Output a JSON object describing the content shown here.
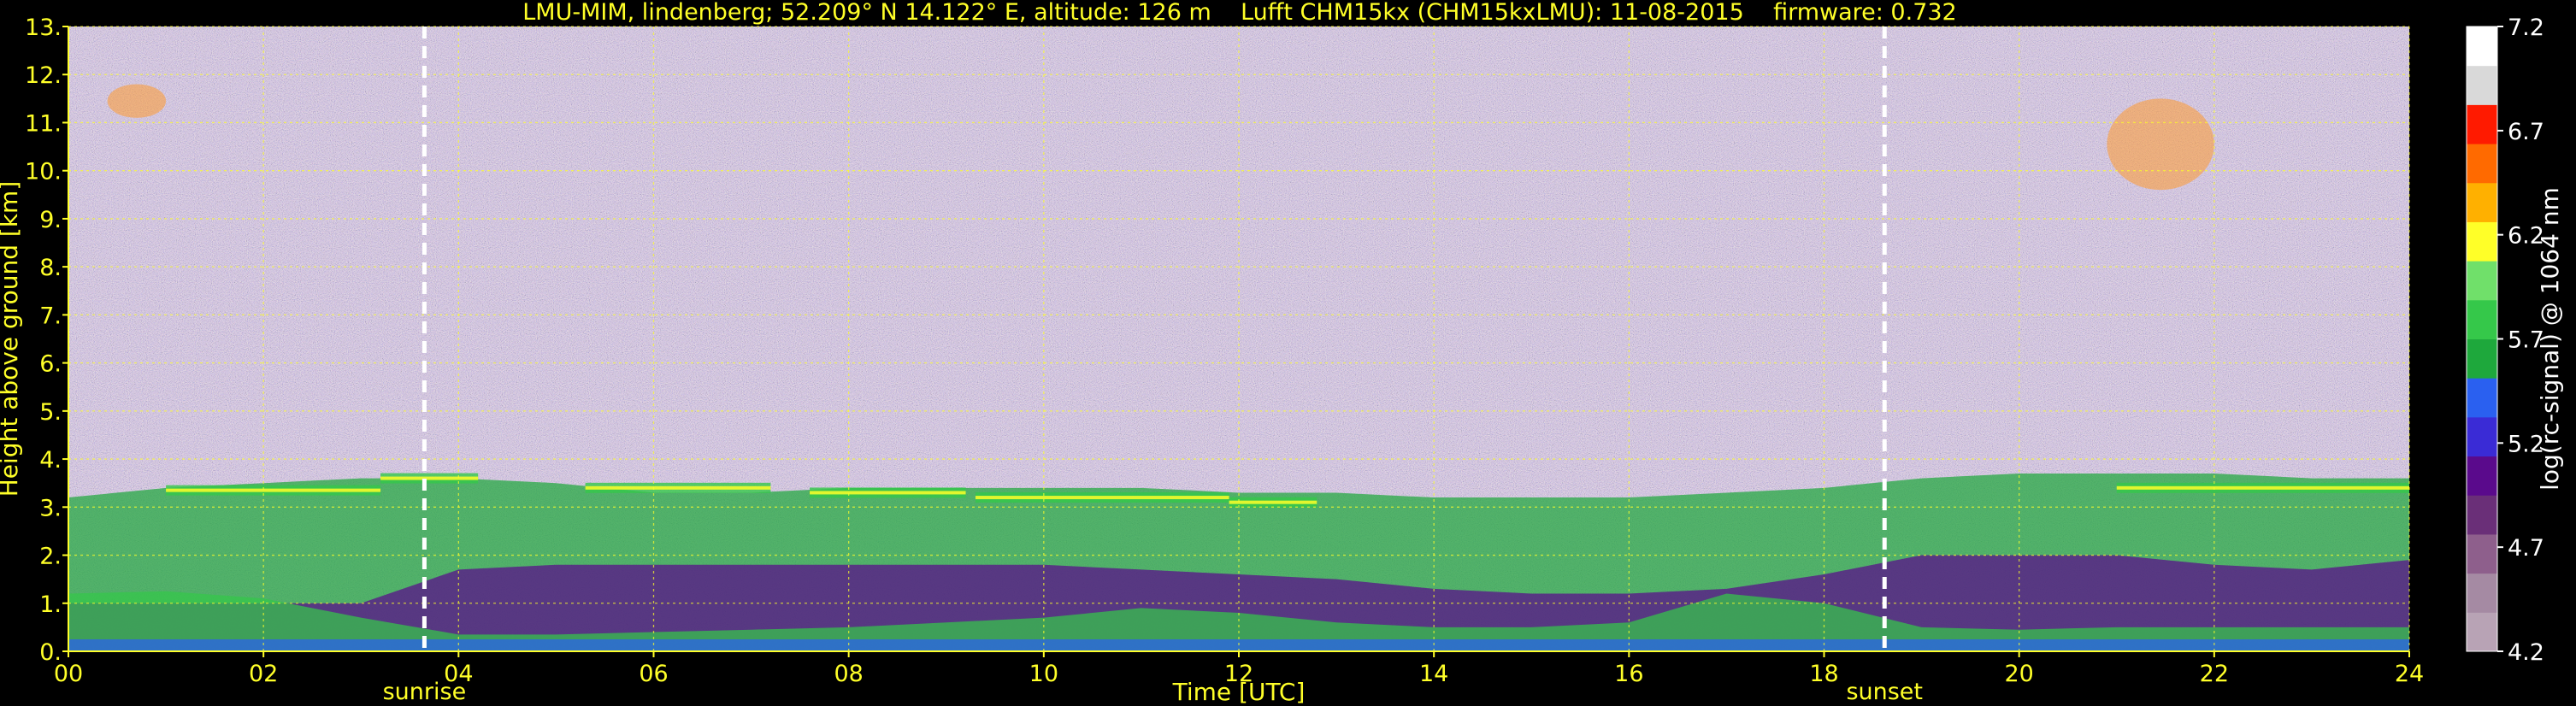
{
  "chart_data": {
    "type": "heatmap",
    "title": "LMU-MIM, lindenberg; 52.209° N 14.122° E, altitude: 126 m    Lufft CHM15kx (CHM15kxLMU): 11-08-2015    firmware: 0.732",
    "xlabel": "Time [UTC]",
    "ylabel": "Height above ground [km]",
    "xlim": [
      0,
      24
    ],
    "ylim": [
      0,
      13
    ],
    "x_ticks": [
      0,
      2,
      4,
      6,
      8,
      10,
      12,
      14,
      16,
      18,
      20,
      22,
      24
    ],
    "x_tick_labels": [
      "00",
      "02",
      "04",
      "06",
      "08",
      "10",
      "12",
      "14",
      "16",
      "18",
      "20",
      "22",
      "24"
    ],
    "y_ticks": [
      0,
      1,
      2,
      3,
      4,
      5,
      6,
      7,
      8,
      9,
      10,
      11,
      12,
      13
    ],
    "y_tick_labels": [
      "0.",
      "1.",
      "2.",
      "3.",
      "4.",
      "5.",
      "6.",
      "7.",
      "8.",
      "9.",
      "10.",
      "11.",
      "12.",
      "13."
    ],
    "grid": true,
    "events": [
      {
        "label": "sunrise",
        "x": 3.65
      },
      {
        "label": "sunset",
        "x": 18.62
      }
    ],
    "colorbar": {
      "label": "log(rc-signal) @ 1064 nm",
      "range": [
        4.2,
        7.2
      ],
      "tick_values": [
        4.2,
        4.7,
        5.2,
        5.7,
        6.2,
        6.7,
        7.2
      ],
      "tick_labels": [
        "4.2",
        "4.7",
        "5.2",
        "5.7",
        "6.2",
        "6.7",
        "7.2"
      ],
      "colors": [
        "#b8a3b5",
        "#a58aa3",
        "#8e5f8c",
        "#6a2f78",
        "#5a0a8c",
        "#3a2bd6",
        "#2a60f0",
        "#1ea83c",
        "#35c84a",
        "#70e06a",
        "#ffff28",
        "#ffb000",
        "#ff6a00",
        "#ff1a00",
        "#d9d9d9",
        "#ffffff"
      ]
    },
    "layers": [
      {
        "x": [
          0,
          1,
          2,
          3,
          4,
          5,
          6,
          7,
          8,
          9,
          10,
          11,
          12,
          13,
          14,
          15,
          16,
          17,
          18,
          19,
          20,
          21,
          22,
          23,
          24
        ],
        "y": [
          0.25,
          0.25,
          0.25,
          0.25,
          0.25,
          0.25,
          0.25,
          0.25,
          0.25,
          0.25,
          0.25,
          0.25,
          0.25,
          0.25,
          0.25,
          0.25,
          0.25,
          0.25,
          0.25,
          0.25,
          0.25,
          0.25,
          0.25,
          0.25,
          0.25
        ],
        "value": 5.45
      },
      {
        "x": [
          0,
          1,
          2,
          3,
          4,
          5,
          6,
          7,
          8,
          9,
          10,
          11,
          12,
          13,
          14,
          15,
          16,
          17,
          18,
          19,
          20,
          21,
          22,
          23,
          24
        ],
        "y": [
          1.2,
          1.25,
          1.1,
          0.7,
          0.35,
          0.35,
          0.4,
          0.45,
          0.5,
          0.6,
          0.7,
          0.9,
          0.8,
          0.6,
          0.5,
          0.5,
          0.6,
          1.2,
          1.0,
          0.5,
          0.45,
          0.5,
          0.5,
          0.5,
          0.5
        ],
        "value": 5.8
      },
      {
        "x": [
          0,
          1,
          2,
          3,
          4,
          5,
          6,
          7,
          8,
          9,
          10,
          11,
          12,
          13,
          14,
          15,
          16,
          17,
          18,
          19,
          20,
          21,
          22,
          23,
          24
        ],
        "y": [
          1.0,
          1.0,
          1.0,
          1.0,
          1.7,
          1.8,
          1.8,
          1.8,
          1.8,
          1.8,
          1.8,
          1.7,
          1.6,
          1.5,
          1.3,
          1.2,
          1.2,
          1.3,
          1.6,
          2.0,
          2.0,
          2.0,
          1.8,
          1.7,
          1.9
        ],
        "value": 5.1
      },
      {
        "x": [
          0,
          1,
          2,
          3,
          4,
          5,
          6,
          7,
          8,
          9,
          10,
          11,
          12,
          13,
          14,
          15,
          16,
          17,
          18,
          19,
          20,
          21,
          22,
          23,
          24
        ],
        "y": [
          3.2,
          3.4,
          3.5,
          3.6,
          3.6,
          3.5,
          3.3,
          3.3,
          3.4,
          3.4,
          3.4,
          3.4,
          3.3,
          3.3,
          3.2,
          3.2,
          3.2,
          3.3,
          3.4,
          3.6,
          3.7,
          3.7,
          3.7,
          3.6,
          3.6
        ],
        "value": 5.6
      }
    ],
    "aerosol_top_features": [
      {
        "x_start": 1.0,
        "x_end": 3.2,
        "height": 3.35
      },
      {
        "x_start": 3.2,
        "x_end": 4.2,
        "height": 3.6
      },
      {
        "x_start": 5.3,
        "x_end": 7.2,
        "height": 3.4
      },
      {
        "x_start": 7.6,
        "x_end": 9.2,
        "height": 3.3
      },
      {
        "x_start": 9.3,
        "x_end": 11.9,
        "height": 3.2
      },
      {
        "x_start": 11.9,
        "x_end": 12.8,
        "height": 3.1
      },
      {
        "x_start": 21.0,
        "x_end": 24.0,
        "height": 3.4
      }
    ],
    "cloud_patches": [
      {
        "x_start": 0.4,
        "x_end": 1.0,
        "height_min": 11.1,
        "height_max": 11.8
      },
      {
        "x_start": 20.9,
        "x_end": 22.0,
        "height_min": 9.6,
        "height_max": 11.5
      }
    ]
  }
}
